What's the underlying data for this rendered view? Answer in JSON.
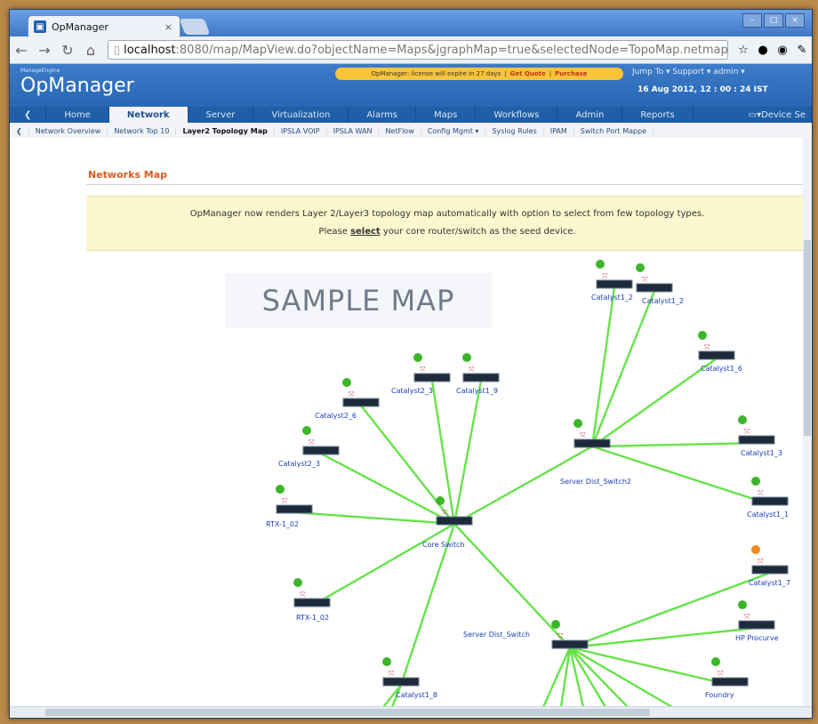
{
  "browser": {
    "tab_title": "OpManager",
    "tab_close": "×",
    "url_host": "localhost",
    "url_rest": ":8080/map/MapView.do?objectName=Maps&jgraphMap=true&selectedNode=TopoMap.netmap&vie"
  },
  "app": {
    "logo_small": "ManageEngine",
    "logo": "OpManager",
    "banner_text": "OpManager: license will expire in 27 days",
    "banner_quote": "Get Quote",
    "banner_purchase": "Purchase",
    "top_links": "Jump To ▾   Support ▾   admin ▾",
    "datetime": "16 Aug 2012, 12 : 00 : 24 IST"
  },
  "mainnav": {
    "items": [
      "Home",
      "Network",
      "Server",
      "Virtualization",
      "Alarms",
      "Maps",
      "Workflows",
      "Admin",
      "Reports"
    ],
    "device_search": "Device Se"
  },
  "subnav": {
    "items": [
      "Network Overview",
      "Network Top 10",
      "Layer2 Topology Map",
      "IPSLA VOIP",
      "IPSLA WAN",
      "NetFlow",
      "Config Mgmt ▾",
      "Syslog Rules",
      "IPAM",
      "Switch Port Mappe"
    ]
  },
  "page": {
    "title": "Networks Map",
    "notice_line1": "OpManager now renders Layer 2/Layer3 topology map automatically with option to select from few topology types.",
    "notice_line2_pre": "Please ",
    "notice_line2_link": "select",
    "notice_line2_post": " your core router/switch as the seed device.",
    "sample_label": "SAMPLE MAP"
  },
  "map": {
    "link_color": "#66e34a",
    "devices": [
      "Catalyst1_2",
      "Catalyst1_2",
      "Catalyst1_6",
      "Catalyst1_3",
      "Catalyst1_1",
      "Catalyst1_7",
      "HP Procurve",
      "Foundry",
      "Server Dist_Switch2",
      "Core Switch",
      "Server Dist_Switch",
      "Catalyst2_3",
      "Catalyst1_9",
      "Catalyst2_6",
      "Catalyst2_3",
      "RTX-1_02",
      "RTX-1_02",
      "Catalyst1_8"
    ]
  }
}
